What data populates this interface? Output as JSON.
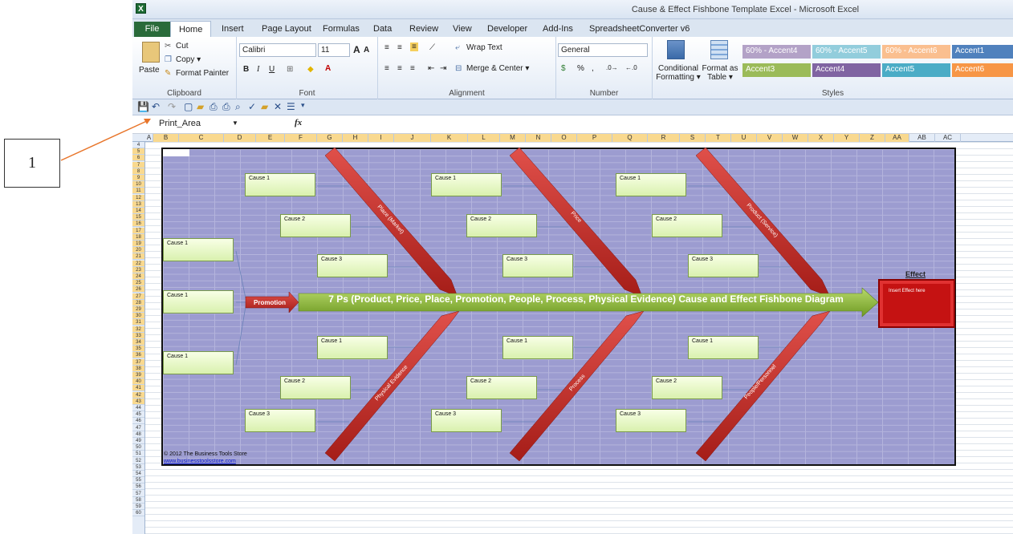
{
  "app": {
    "title": "Cause & Effect Fishbone Template Excel - Microsoft Excel",
    "logo": "X"
  },
  "ribbon_tabs": [
    "File",
    "Home",
    "Insert",
    "Page Layout",
    "Formulas",
    "Data",
    "Review",
    "View",
    "Developer",
    "Add-Ins",
    "SpreadsheetConverter v6"
  ],
  "clipboard": {
    "paste": "Paste",
    "cut": "Cut",
    "copy": "Copy ▾",
    "format_painter": "Format Painter",
    "label": "Clipboard"
  },
  "font": {
    "name": "Calibri",
    "size": "11",
    "label": "Font"
  },
  "alignment": {
    "wrap": "Wrap Text",
    "merge": "Merge & Center ▾",
    "label": "Alignment"
  },
  "number": {
    "format": "General",
    "label": "Number",
    "pct": "%",
    "comma": ","
  },
  "styles": {
    "conditional": "Conditional Formatting ▾",
    "format_table": "Format as Table ▾",
    "label": "Styles",
    "tiles": [
      {
        "text": "60% - Accent4",
        "color": "#b3a2c7"
      },
      {
        "text": "60% - Accent5",
        "color": "#92cddc"
      },
      {
        "text": "60% - Accent6",
        "color": "#fabf8f"
      },
      {
        "text": "Accent1",
        "color": "#4f81bd"
      },
      {
        "text": "Accent3",
        "color": "#9bbb59"
      },
      {
        "text": "Accent4",
        "color": "#8064a2"
      },
      {
        "text": "Accent5",
        "color": "#4bacc6"
      },
      {
        "text": "Accent6",
        "color": "#f79646"
      }
    ]
  },
  "formula_bar": {
    "name_box": "Print_Area",
    "fx": "fx",
    "value": ""
  },
  "columns": [
    "A",
    "B",
    "C",
    "D",
    "E",
    "F",
    "G",
    "H",
    "I",
    "J",
    "K",
    "L",
    "M",
    "N",
    "O",
    "P",
    "Q",
    "R",
    "S",
    "T",
    "U",
    "V",
    "W",
    "X",
    "Y",
    "Z",
    "AA",
    "AB",
    "AC"
  ],
  "rows": [
    "4",
    "5",
    "6",
    "7",
    "8",
    "9",
    "10",
    "11",
    "12",
    "13",
    "14",
    "15",
    "16",
    "17",
    "18",
    "19",
    "20",
    "21",
    "22",
    "23",
    "24",
    "25",
    "26",
    "27",
    "28",
    "29",
    "30",
    "31",
    "32",
    "33",
    "34",
    "35",
    "36",
    "37",
    "38",
    "39",
    "40",
    "41",
    "42",
    "43",
    "44",
    "45",
    "46",
    "47",
    "48",
    "49",
    "50",
    "51",
    "52",
    "53",
    "54",
    "55",
    "56",
    "57",
    "58",
    "59",
    "60"
  ],
  "diagram": {
    "title": "7 Ps (Product, Price, Place, Promotion, People, Process, Physical Evidence) Cause and Effect Fishbone Diagram",
    "promotion": "Promotion",
    "bones": {
      "place": "Place (Market)",
      "price": "Price",
      "product": "Product (Service)",
      "physical": "Physical Evidence",
      "process": "Process",
      "people": "People/Personnel"
    },
    "effect_label": "Effect",
    "effect_text": "Insert Effect here",
    "cause1": "Cause 1",
    "cause2": "Cause 2",
    "cause3": "Cause 3",
    "copyright": "© 2012 The Business Tools Store",
    "link": "www.businesstoolsstore.com"
  },
  "callout": "1",
  "colors": {
    "accent": "#1d6b34",
    "diagram_bg": "#9c9cd0",
    "bone": "#c9302c",
    "spine": "#8fbf3a"
  }
}
